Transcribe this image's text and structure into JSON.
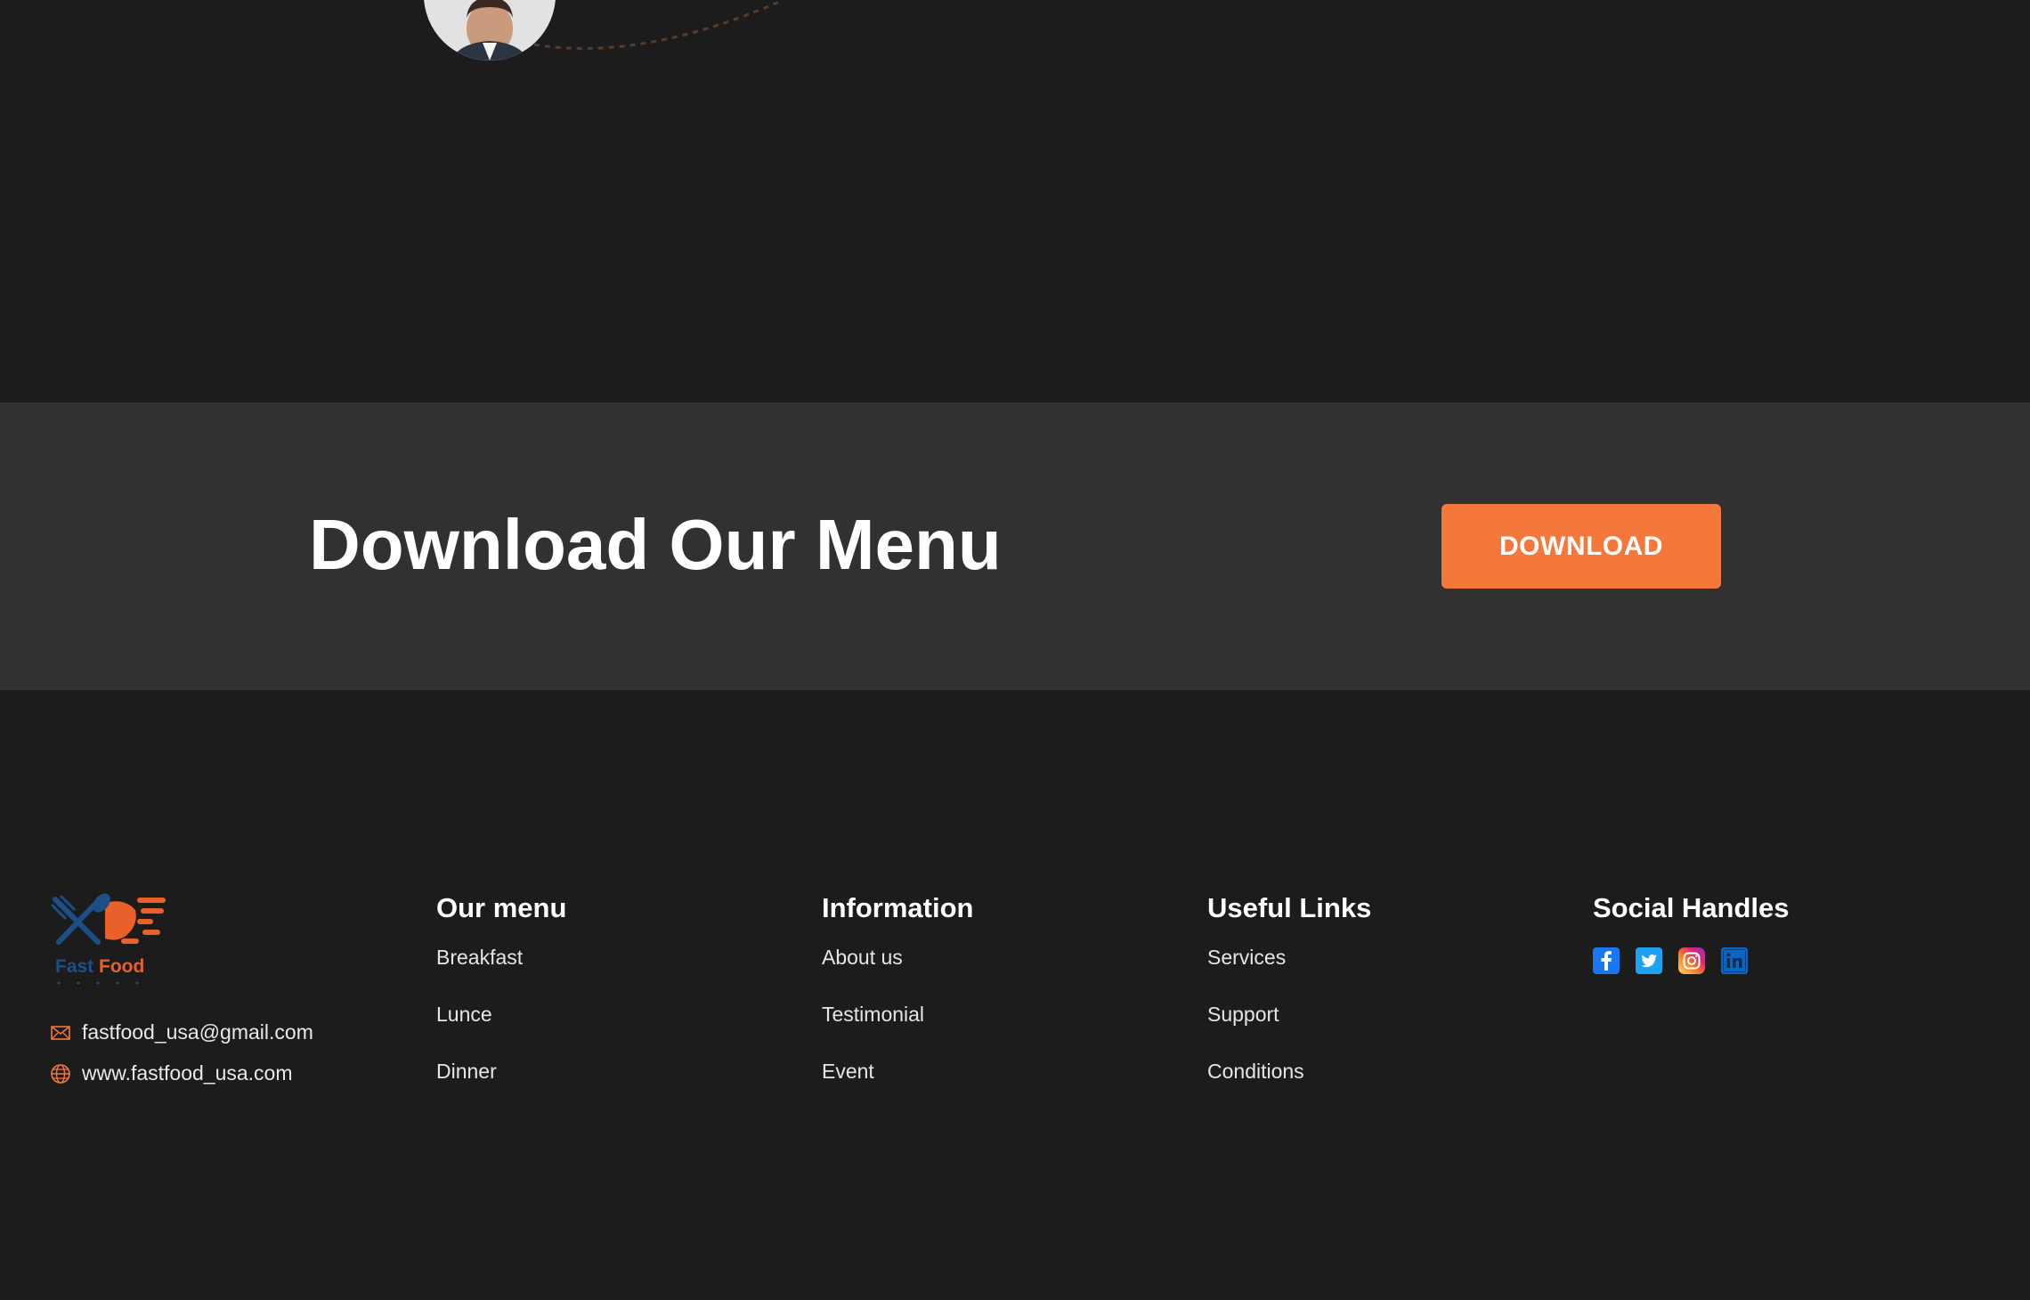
{
  "download_section": {
    "title": "Download Our Menu",
    "button_label": "DOWNLOAD"
  },
  "footer": {
    "logo": {
      "text_fast": "Fast",
      "text_food": "Food",
      "icon": "fork-knife-speed-logo"
    },
    "contact": {
      "email": "fastfood_usa@gmail.com",
      "website": "www.fastfood_usa.com",
      "email_icon": "mail-icon",
      "website_icon": "globe-icon"
    },
    "columns": [
      {
        "heading": "Our menu",
        "links": [
          "Breakfast",
          "Lunce",
          "Dinner"
        ]
      },
      {
        "heading": "Information",
        "links": [
          "About us",
          "Testimonial",
          "Event"
        ]
      },
      {
        "heading": "Useful Links",
        "links": [
          "Services",
          "Support",
          "Conditions"
        ]
      }
    ],
    "social": {
      "heading": "Social Handles",
      "icons": [
        "facebook-icon",
        "twitter-icon",
        "instagram-icon",
        "linkedin-icon"
      ]
    }
  },
  "colors": {
    "background": "#1c1c1c",
    "band": "#323031",
    "accent": "#f4773b",
    "logo_blue": "#1d4f86"
  }
}
